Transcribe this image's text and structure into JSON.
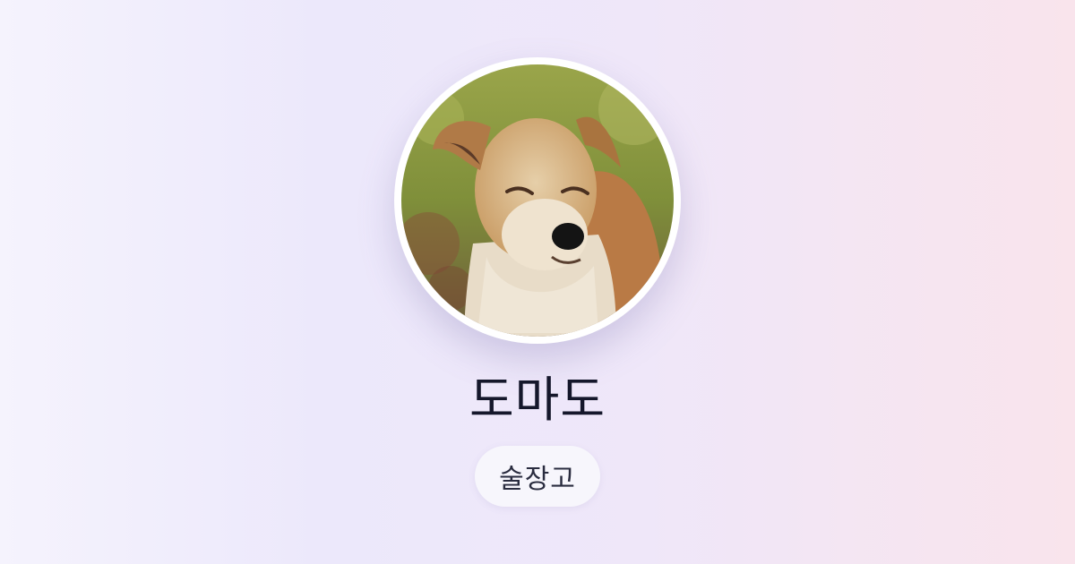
{
  "profile": {
    "avatar_icon": "dog-photo-avatar",
    "name": "도마도",
    "tag": "술장고"
  },
  "colors": {
    "ring": "#ffffff",
    "name_text": "#15172b",
    "pill_bg": "#f7f6fc",
    "pill_text": "#2a2c3f"
  }
}
